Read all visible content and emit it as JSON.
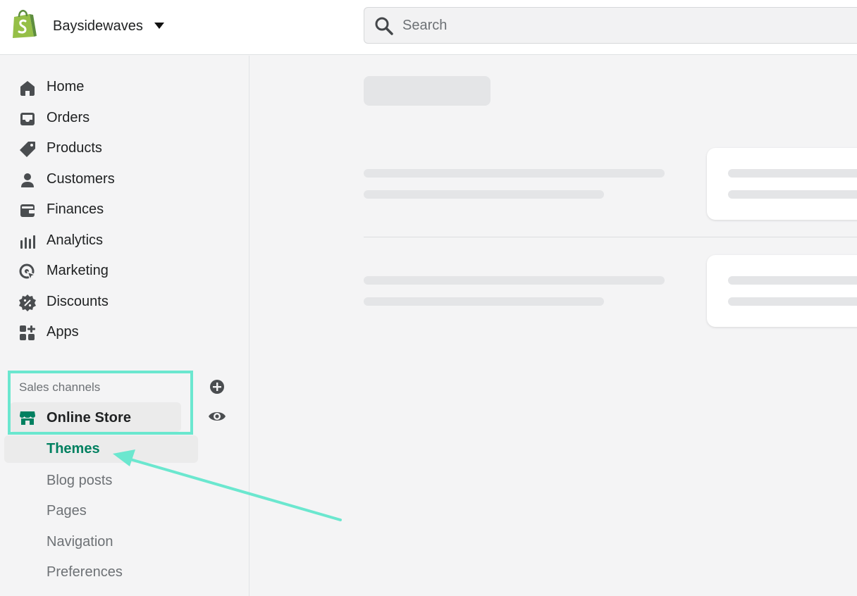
{
  "topbar": {
    "store_name": "Baysidewaves",
    "search_placeholder": "Search"
  },
  "sidebar": {
    "items": [
      {
        "label": "Home",
        "icon": "home-icon"
      },
      {
        "label": "Orders",
        "icon": "inbox-icon"
      },
      {
        "label": "Products",
        "icon": "tag-icon"
      },
      {
        "label": "Customers",
        "icon": "person-icon"
      },
      {
        "label": "Finances",
        "icon": "wallet-icon"
      },
      {
        "label": "Analytics",
        "icon": "bar-chart-icon"
      },
      {
        "label": "Marketing",
        "icon": "target-icon"
      },
      {
        "label": "Discounts",
        "icon": "discount-icon"
      },
      {
        "label": "Apps",
        "icon": "apps-icon"
      }
    ],
    "sales_channels": {
      "title": "Sales channels",
      "online_store": "Online Store",
      "sub_items": [
        "Themes",
        "Blog posts",
        "Pages",
        "Navigation",
        "Preferences"
      ],
      "active_sub_item": "Themes"
    }
  },
  "colors": {
    "accent_green": "#008060",
    "highlight": "#6be7cf",
    "skeleton": "#e4e5e7"
  }
}
